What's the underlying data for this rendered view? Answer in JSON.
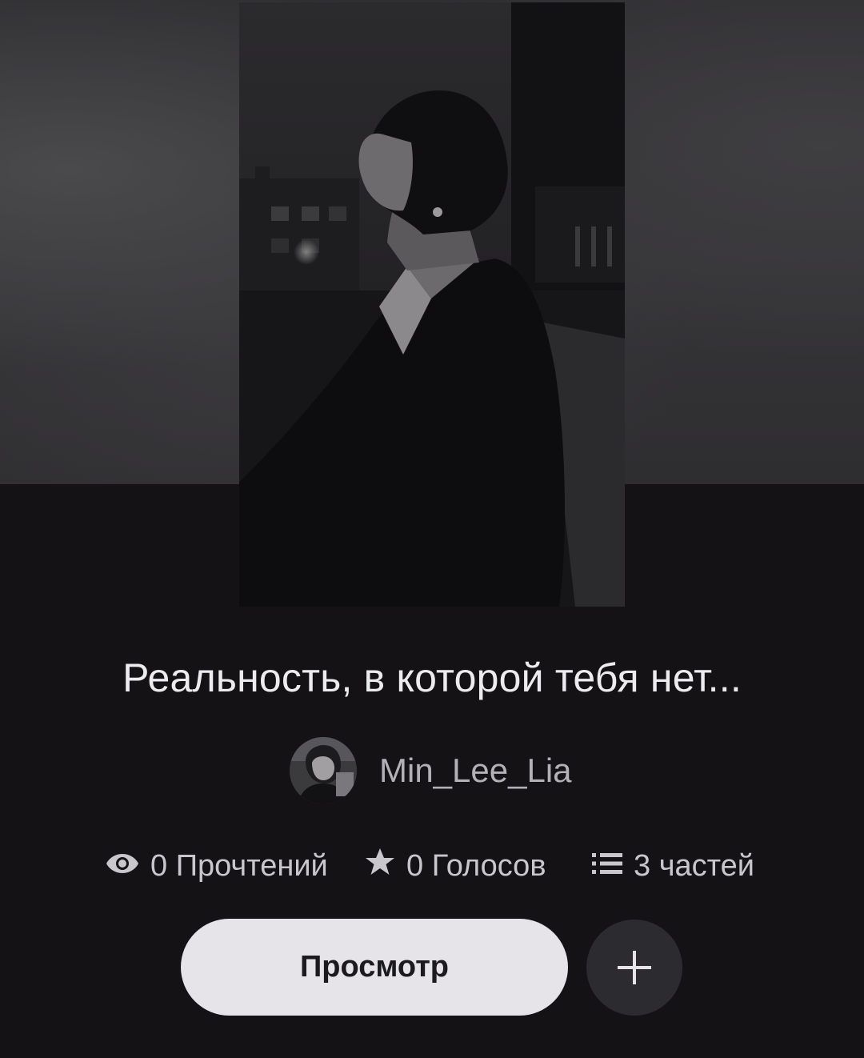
{
  "story": {
    "title": "Реальность, в которой тебя нет...",
    "cover_icon": "cover-image",
    "author": {
      "name": "Min_Lee_Lia",
      "avatar_icon": "avatar-image"
    }
  },
  "stats": {
    "reads": {
      "icon": "eye-icon",
      "label": "0 Прочтений"
    },
    "votes": {
      "icon": "star-icon",
      "label": "0 Голосов"
    },
    "parts": {
      "icon": "list-icon",
      "label": "3 частей"
    }
  },
  "actions": {
    "view_label": "Просмотр",
    "add_icon": "plus-icon"
  },
  "colors": {
    "background": "#141215",
    "view_button_bg": "#e6e4e8",
    "add_button_bg": "#2c2b2f",
    "title_text": "#ecebee",
    "muted_text": "#b3b1b6"
  }
}
